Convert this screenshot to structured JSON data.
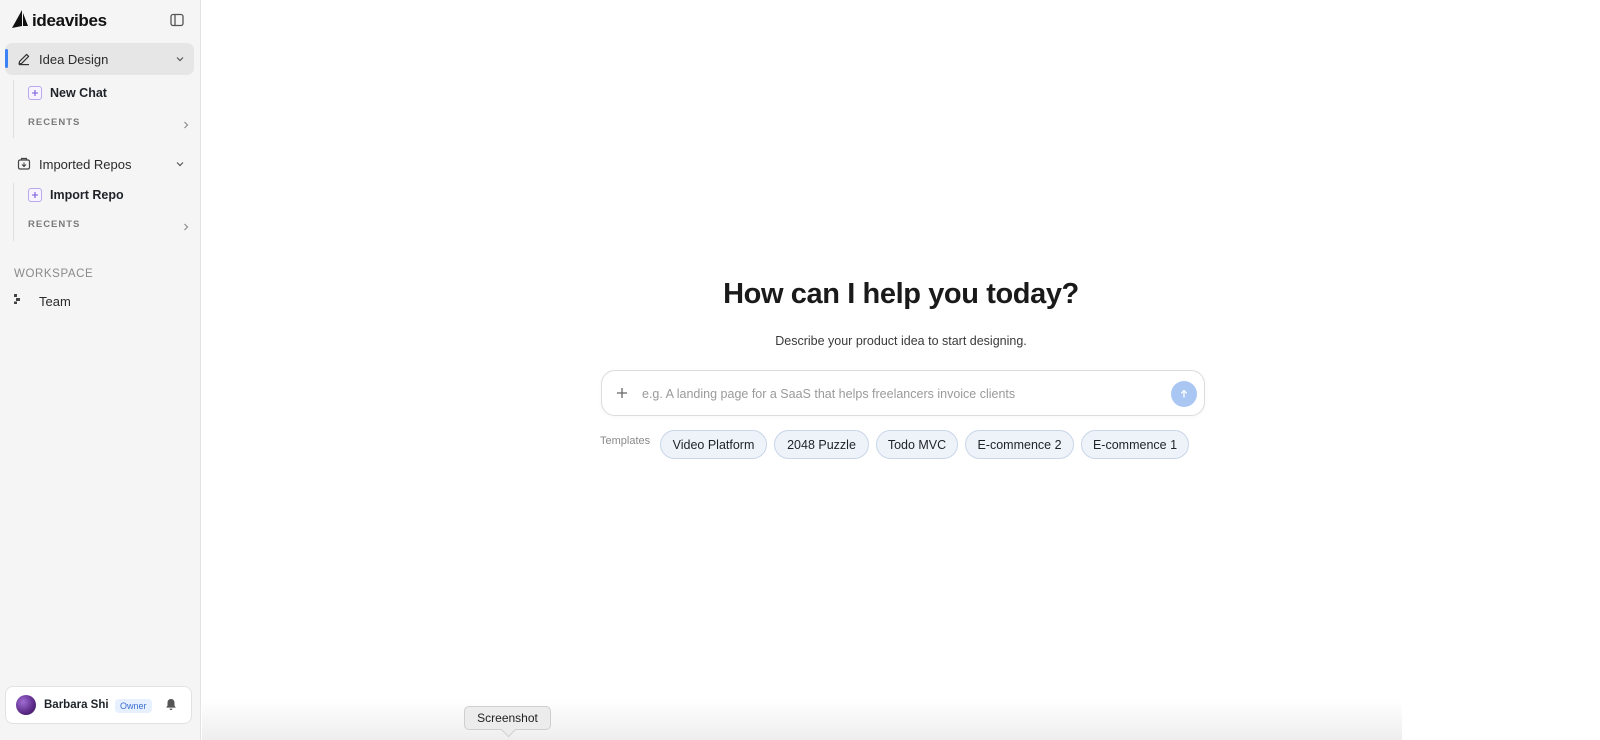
{
  "app": {
    "brand": "ideavibes",
    "logo_icon": "sail-logo-icon"
  },
  "sidebar": {
    "sections": [
      {
        "label": "Idea Design",
        "icon": "pen-icon",
        "active": true,
        "action_label": "New Chat",
        "recents_label": "RECENTS"
      },
      {
        "label": "Imported Repos",
        "icon": "repo-icon",
        "active": false,
        "action_label": "Import Repo",
        "recents_label": "RECENTS"
      }
    ],
    "workspace_label": "WORKSPACE",
    "team_label": "Team"
  },
  "user": {
    "name": "Barbara Shi",
    "role": "Owner"
  },
  "main": {
    "headline": "How can I help you today?",
    "subline": "Describe your product idea to start designing.",
    "prompt_placeholder": "e.g. A landing page for a SaaS that helps freelancers invoice clients",
    "templates_label": "Templates",
    "templates": [
      "Video Platform",
      "2048 Puzzle",
      "Todo MVC",
      "E-commence 2",
      "E-commence 1"
    ]
  },
  "tooltip": "Screenshot",
  "colors": {
    "accent": "#3b82f6",
    "send_button": "#a9c7f2",
    "chip_bg": "#eef3fa",
    "badge_text": "#3b6fd1"
  }
}
